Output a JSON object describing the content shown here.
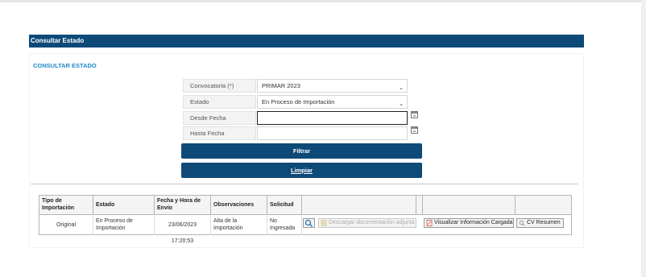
{
  "window": {
    "title": "Consultar Estado"
  },
  "section_title": "CONSULTAR ESTADO",
  "form": {
    "convocatoria": {
      "label": "Convocatoria (*)",
      "value": "PRIMAR 2023"
    },
    "estado": {
      "label": "Estado",
      "value": "En Proceso de Importación"
    },
    "desde": {
      "label": "Desde Fecha",
      "value": ""
    },
    "hasta": {
      "label": "Hasta Fecha",
      "value": ""
    }
  },
  "buttons": {
    "filtrar": "Filtrar",
    "limpiar": "Limpiar"
  },
  "table": {
    "headers": [
      "Tipo de Importación",
      "Estado",
      "Fecha y Hora de Envío",
      "Observaciones",
      "Solicitud",
      "",
      "",
      "",
      ""
    ],
    "rows": [
      {
        "tipo": "Original",
        "estado": "En Proceso de Importación",
        "fecha": "23/06/2023 17:20:53",
        "observaciones": "Alta de la Importación",
        "solicitud": "No Ingresada"
      }
    ],
    "actions": {
      "descargar": "Descargar documentación adjunta",
      "visualizar": "Visualizar Información Cargada",
      "cv": "CV Resumen"
    }
  },
  "icons": [
    "calendar-icon",
    "magnifier-icon",
    "document-icon",
    "pdf-icon"
  ]
}
